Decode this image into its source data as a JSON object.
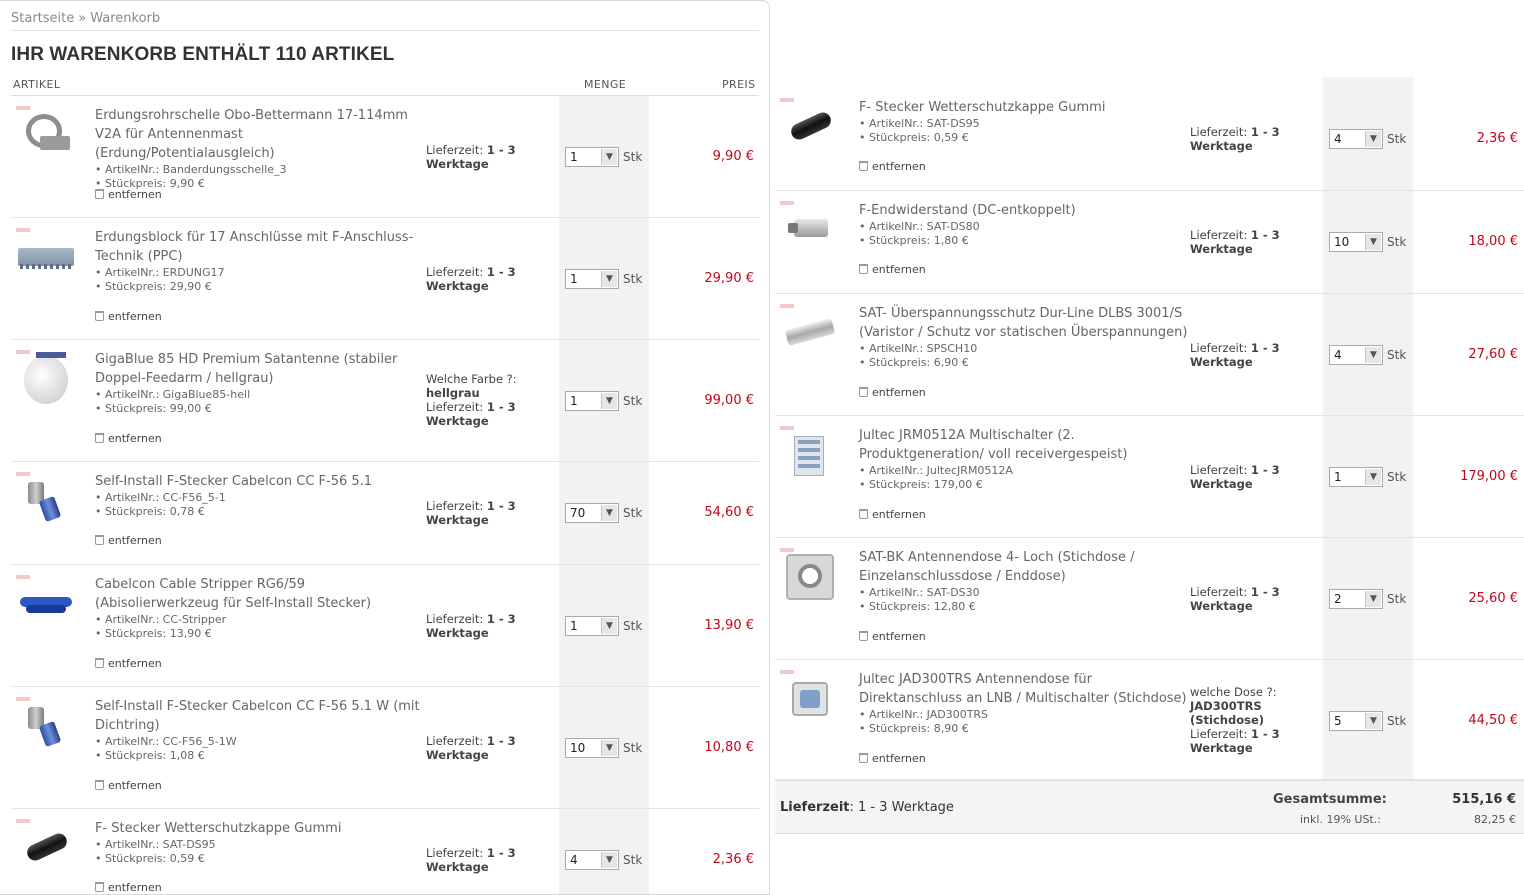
{
  "breadcrumb": {
    "home": "Startseite",
    "separator": "»",
    "current": "Warenkorb"
  },
  "page_title": "IHR WARENKORB ENTHÄLT 110 ARTIKEL",
  "columns": {
    "article": "ARTIKEL",
    "quantity": "MENGE",
    "price": "PREIS"
  },
  "labels": {
    "artnr": "• ArtikelNr.:",
    "unit_price": "• Stückpreis:",
    "remove": "entfernen",
    "delivery_label": "Lieferzeit:",
    "delivery_value": "1 - 3",
    "delivery_unit": "Werktage",
    "unit": "Stk"
  },
  "left_items": [
    {
      "thumb": "clamp-image",
      "name": "Erdungsrohrschelle Obo-Bettermann 17-114mm V2A für Antennenmast (Erdung/Potentialausgleich)",
      "artnr": "Banderdungsschelle_3",
      "unit_price": "9,90 €",
      "option_label": "",
      "option_value": "",
      "qty": "1",
      "price": "9,90 €"
    },
    {
      "thumb": "block-image",
      "name": "Erdungsblock für 17 Anschlüsse mit F-Anschluss-Technik (PPC)",
      "artnr": "ERDUNG17",
      "unit_price": "29,90 €",
      "option_label": "",
      "option_value": "",
      "qty": "1",
      "price": "29,90 €"
    },
    {
      "thumb": "dish-image",
      "name": "GigaBlue 85 HD Premium Satantenne (stabiler Doppel-Feedarm / hellgrau)",
      "artnr": "GigaBlue85-hell",
      "unit_price": "99,00 €",
      "option_label": "Welche Farbe ?:",
      "option_value": "hellgrau",
      "qty": "1",
      "price": "99,00 €"
    },
    {
      "thumb": "fplug-image",
      "name": "Self-Install F-Stecker Cabelcon CC F-56 5.1",
      "artnr": "CC-F56_5-1",
      "unit_price": "0,78 €",
      "option_label": "",
      "option_value": "",
      "qty": "70",
      "price": "54,60 €"
    },
    {
      "thumb": "stripper-image",
      "name": "Cabelcon Cable Stripper RG6/59 (Abisolierwerkzeug für Self-Install Stecker)",
      "artnr": "CC-Stripper",
      "unit_price": "13,90 €",
      "option_label": "",
      "option_value": "",
      "qty": "1",
      "price": "13,90 €"
    },
    {
      "thumb": "fplug-image",
      "name": "Self-Install F-Stecker Cabelcon CC F-56 5.1 W (mit Dichtring)",
      "artnr": "CC-F56_5-1W",
      "unit_price": "1,08 €",
      "option_label": "",
      "option_value": "",
      "qty": "10",
      "price": "10,80 €"
    },
    {
      "thumb": "cap-image",
      "name": "F- Stecker Wetterschutzkappe Gummi",
      "artnr": "SAT-DS95",
      "unit_price": "0,59 €",
      "option_label": "",
      "option_value": "",
      "qty": "4",
      "price": "2,36 €"
    }
  ],
  "right_items": [
    {
      "thumb": "cap-image",
      "name": "F- Stecker Wetterschutzkappe Gummi",
      "artnr": "SAT-DS95",
      "unit_price": "0,59 €",
      "option_label": "",
      "option_value": "",
      "qty": "4",
      "price": "2,36 €"
    },
    {
      "thumb": "term-image",
      "name": "F-Endwiderstand (DC-entkoppelt)",
      "artnr": "SAT-DS80",
      "unit_price": "1,80 €",
      "option_label": "",
      "option_value": "",
      "qty": "10",
      "price": "18,00 €"
    },
    {
      "thumb": "surge-image",
      "name": "SAT- Überspannungsschutz Dur-Line DLBS 3001/S (Varistor / Schutz vor statischen Überspannungen)",
      "artnr": "SPSCH10",
      "unit_price": "6,90 €",
      "option_label": "",
      "option_value": "",
      "qty": "4",
      "price": "27,60 €"
    },
    {
      "thumb": "switch-image",
      "name": "Jultec JRM0512A Multischalter (2. Produktgeneration/ voll receivergespeist)",
      "artnr": "JultecJRM0512A",
      "unit_price": "179,00 €",
      "option_label": "",
      "option_value": "",
      "qty": "1",
      "price": "179,00 €"
    },
    {
      "thumb": "socket-image",
      "name": "SAT-BK Antennendose 4- Loch (Stichdose / Einzelanschlussdose / Enddose)",
      "artnr": "SAT-DS30",
      "unit_price": "12,80 €",
      "option_label": "",
      "option_value": "",
      "qty": "2",
      "price": "25,60 €"
    },
    {
      "thumb": "dose-image",
      "name": "Jultec JAD300TRS Antennendose für Direktanschluss an LNB / Multischalter (Stichdose)",
      "artnr": "JAD300TRS",
      "unit_price": "8,90 €",
      "option_label": "welche Dose ?:",
      "option_value": "JAD300TRS (Stichdose)",
      "qty": "5",
      "price": "44,50 €"
    }
  ],
  "totals": {
    "delivery_label": "Lieferzeit",
    "delivery_value": ": 1 - 3 Werktage",
    "sum_label": "Gesamtsumme:",
    "sum_value": "515,16 €",
    "tax_label": "inkl. 19% USt.:",
    "tax_value": "82,25 €"
  },
  "colors": {
    "price": "#c0071d",
    "qty_band": "#f2f2f2",
    "border": "#e4e4e4"
  }
}
